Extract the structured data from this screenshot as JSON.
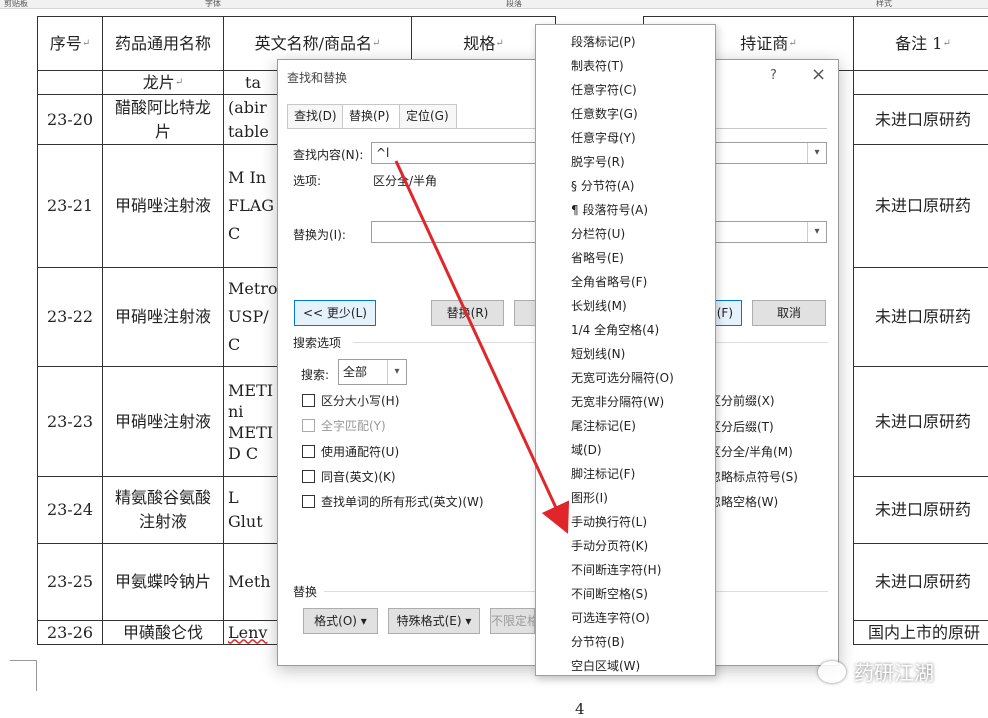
{
  "ribbon": {
    "groups": [
      "剪贴板",
      "字体",
      "段落",
      "样式"
    ]
  },
  "table": {
    "headers": [
      "序号",
      "药品通用名称",
      "英文名称/商品名",
      "规格",
      "持证商",
      "备注 1"
    ],
    "rows": [
      {
        "id": "",
        "name": "龙片",
        "english": "ta"
      },
      {
        "id": "23-20",
        "name": "醋酸阿比特龙片",
        "english": "(abir table",
        "remark": "未进口原研药"
      },
      {
        "id": "23-21",
        "name": "甲硝唑注射液",
        "english": "M In FLAG C",
        "remark": "未进口原研药"
      },
      {
        "id": "23-22",
        "name": "甲硝唑注射液",
        "english": "Metro USP/ C",
        "remark": "未进口原研药"
      },
      {
        "id": "23-23",
        "name": "甲硝唑注射液",
        "english": "METI ni METI D C",
        "remark": "未进口原研药"
      },
      {
        "id": "23-24",
        "name": "精氨酸谷氨酸注射液",
        "english": "L Glut",
        "remark": "未进口原研药"
      },
      {
        "id": "23-25",
        "name": "甲氨蝶呤钠片",
        "english": "Meth",
        "remark": "未进口原研药"
      },
      {
        "id": "23-26",
        "name": "甲磺酸仑伐",
        "english": "Lenv",
        "remark": "国内上市的原研"
      }
    ],
    "page_number": "4"
  },
  "dialog": {
    "title": "查找和替换",
    "help": "?",
    "close": "×",
    "tabs": [
      "查找(D)",
      "替换(P)",
      "定位(G)"
    ],
    "find_label": "查找内容(N):",
    "find_value": "^l",
    "options_label": "选项:",
    "options_value": "区分全/半角",
    "replace_label": "替换为(I):",
    "replace_value": "",
    "less_button": "<< 更少(L)",
    "replace_button": "替换(R)",
    "find_next_button": "查找下一处(F)",
    "find_next_visible": "(F)",
    "cancel_button": "取消",
    "search_options_title": "搜索选项",
    "search_label": "搜索:",
    "search_value": "全部",
    "checks_left": [
      "区分大小写(H)",
      "全字匹配(Y)",
      "使用通配符(U)",
      "同音(英文)(K)",
      "查找单词的所有形式(英文)(W)"
    ],
    "checks_right": [
      "区分前缀(X)",
      "区分后缀(T)",
      "区分全/半角(M)",
      "忽略标点符号(S)",
      "忽略空格(W)"
    ],
    "replace_section": "替换",
    "format_button": "格式(O) ▾",
    "special_button": "特殊格式(E) ▾",
    "no_format_button": "不限定格式(T)"
  },
  "special_menu": {
    "items": [
      "段落标记(P)",
      "制表符(T)",
      "任意字符(C)",
      "任意数字(G)",
      "任意字母(Y)",
      "脱字号(R)",
      "§ 分节符(A)",
      "¶ 段落符号(A)",
      "分栏符(U)",
      "省略号(E)",
      "全角省略号(F)",
      "长划线(M)",
      "1/4 全角空格(4)",
      "短划线(N)",
      "无宽可选分隔符(O)",
      "无宽非分隔符(W)",
      "尾注标记(E)",
      "域(D)",
      "脚注标记(F)",
      "图形(I)",
      "手动换行符(L)",
      "手动分页符(K)",
      "不间断连字符(H)",
      "不间断空格(S)",
      "可选连字符(O)",
      "分节符(B)",
      "空白区域(W)"
    ]
  },
  "watermark": {
    "text": "药研江湖"
  },
  "colors": {
    "arrow": "#e0262a",
    "accent": "#0078d7"
  }
}
